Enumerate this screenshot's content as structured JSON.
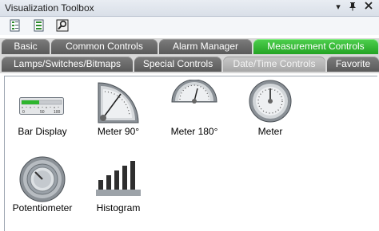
{
  "window": {
    "title": "Visualization Toolbox"
  },
  "title_controls": {
    "dropdown": "▾",
    "pin": "📌",
    "close": "✕"
  },
  "tabs_row1": [
    {
      "label": "Basic",
      "state": "normal"
    },
    {
      "label": "Common Controls",
      "state": "normal"
    },
    {
      "label": "Alarm Manager",
      "state": "normal"
    },
    {
      "label": "Measurement Controls",
      "state": "active"
    }
  ],
  "tabs_row2": [
    {
      "label": "Lamps/Switches/Bitmaps",
      "state": "normal"
    },
    {
      "label": "Special Controls",
      "state": "normal"
    },
    {
      "label": "Date/Time Controls",
      "state": "selected"
    },
    {
      "label": "Favorite",
      "state": "normal"
    }
  ],
  "items": [
    {
      "label": "Bar Display",
      "icon": "bar-display-icon"
    },
    {
      "label": "Meter 90°",
      "icon": "meter-90-icon"
    },
    {
      "label": "Meter 180°",
      "icon": "meter-180-icon"
    },
    {
      "label": "Meter",
      "icon": "meter-icon"
    },
    {
      "label": "Potentiometer",
      "icon": "potentiometer-icon"
    },
    {
      "label": "Histogram",
      "icon": "histogram-icon"
    }
  ],
  "colors": {
    "active_tab": "#2eb52e",
    "tab": "#666666",
    "selected_tab": "#b5b5b5"
  }
}
